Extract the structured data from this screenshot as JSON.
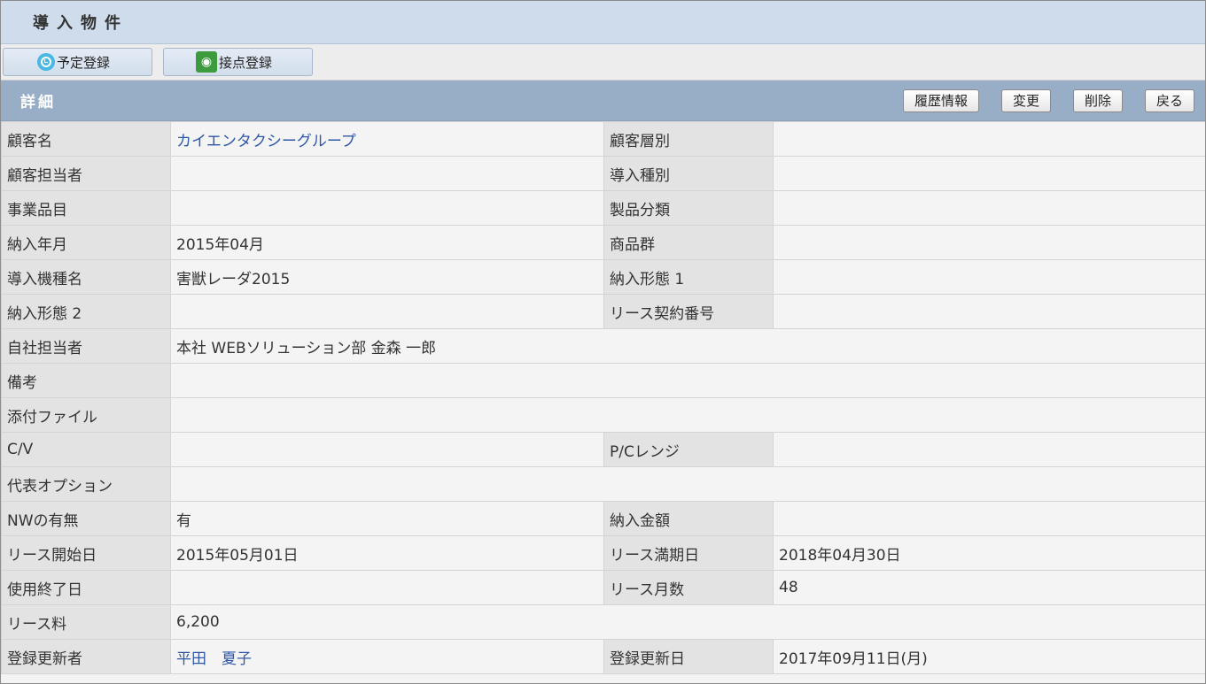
{
  "page": {
    "title": "導入物件"
  },
  "toolbar": {
    "schedule_label": "予定登録",
    "contact_label": "接点登録"
  },
  "section": {
    "title": "詳細",
    "history_label": "履歴情報",
    "edit_label": "変更",
    "delete_label": "削除",
    "back_label": "戻る"
  },
  "details": {
    "customer_name_label": "顧客名",
    "customer_name": "カイエンタクシーグループ",
    "customer_tier_label": "顧客層別",
    "customer_tier": "",
    "customer_contact_label": "顧客担当者",
    "customer_contact": "",
    "install_type_label": "導入種別",
    "install_type": "",
    "business_item_label": "事業品目",
    "business_item": "",
    "product_class_label": "製品分類",
    "product_class": "",
    "delivery_month_label": "納入年月",
    "delivery_month": "2015年04月",
    "product_group_label": "商品群",
    "product_group": "",
    "model_name_label": "導入機種名",
    "model_name": "害獣レーダ2015",
    "delivery_form1_label": "納入形態 1",
    "delivery_form1": "",
    "delivery_form2_label": "納入形態 2",
    "delivery_form2": "",
    "lease_contract_label": "リース契約番号",
    "lease_contract": "",
    "owner_label": "自社担当者",
    "owner": "本社 WEBソリューション部 金森 一郎",
    "remarks_label": "備考",
    "remarks": "",
    "attachment_label": "添付ファイル",
    "attachment": "",
    "cv_label": "C/V",
    "cv": "",
    "pc_range_label": "P/Cレンジ",
    "pc_range": "",
    "main_option_label": "代表オプション",
    "main_option": "",
    "nw_label": "NWの有無",
    "nw": "有",
    "amount_label": "納入金額",
    "amount": "",
    "lease_start_label": "リース開始日",
    "lease_start": "2015年05月01日",
    "lease_end_label": "リース満期日",
    "lease_end": "2018年04月30日",
    "use_end_label": "使用終了日",
    "use_end": "",
    "lease_months_label": "リース月数",
    "lease_months": "48",
    "lease_fee_label": "リース料",
    "lease_fee": "6,200",
    "updater_label": "登録更新者",
    "updater": "平田　夏子",
    "updated_label": "登録更新日",
    "updated": "2017年09月11日(月)"
  },
  "icons": {
    "schedule": "clock-icon",
    "contact": "camera-icon"
  },
  "colors": {
    "header_bg": "#cfdcec",
    "section_bg": "#98aec6",
    "label_bg": "#e3e3e3",
    "link": "#2f57a8"
  }
}
